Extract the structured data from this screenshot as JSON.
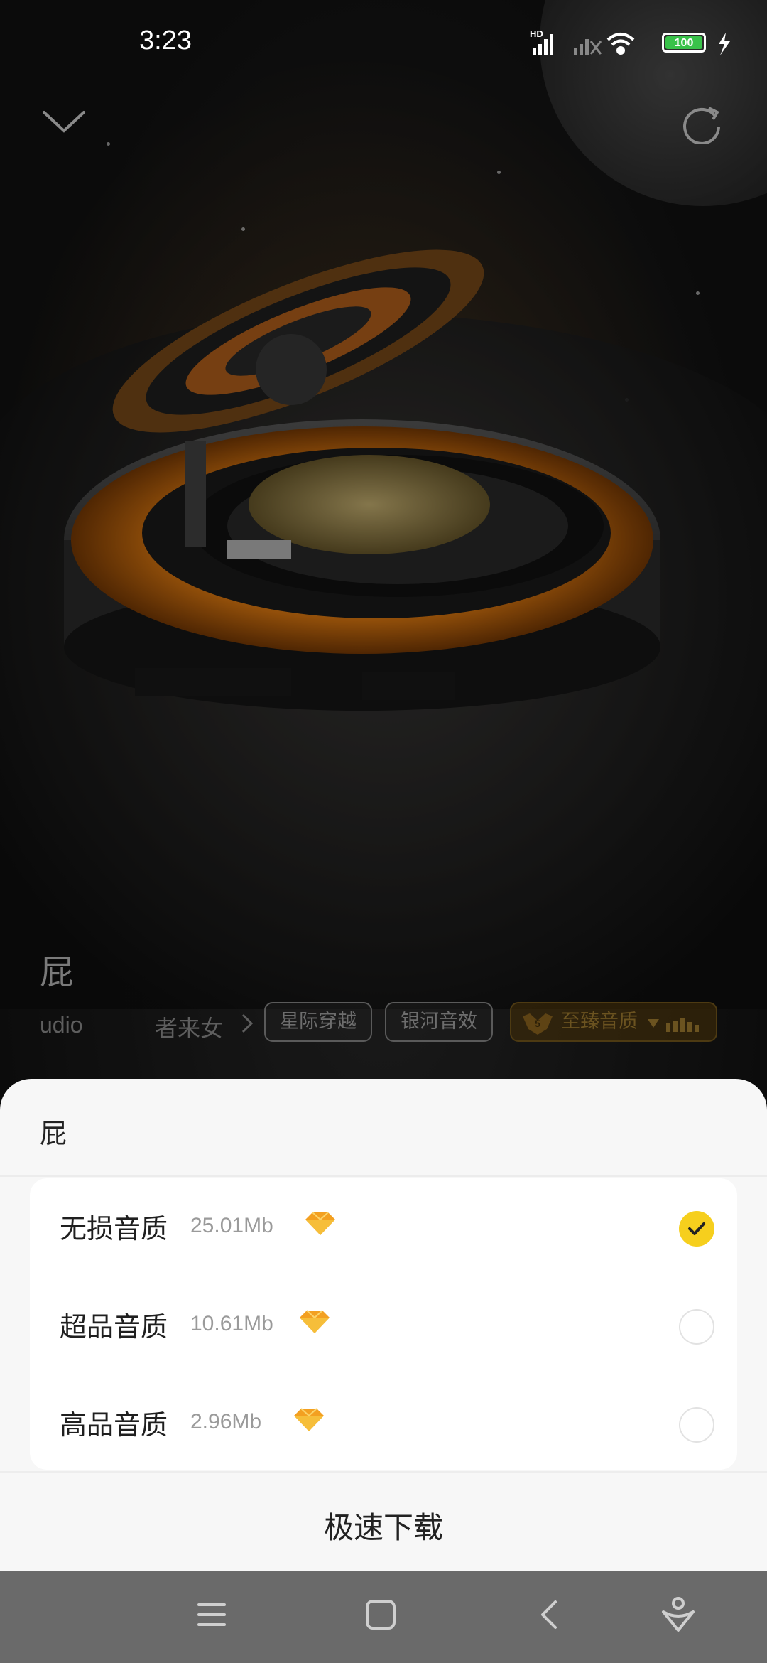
{
  "status_bar": {
    "time": "3:23",
    "network_label": "HD",
    "battery_level": "100",
    "icons": [
      "signal-icon",
      "signal-no-sim-icon",
      "wifi-icon",
      "battery-icon",
      "charging-icon"
    ]
  },
  "player": {
    "collapse_icon": "chevron-down-icon",
    "refresh_icon": "refresh-icon",
    "song_title": "屁",
    "artist_partial": "udio",
    "artist": "者来女",
    "chips": [
      "星际穿越",
      "银河音效"
    ],
    "quality_chip": {
      "badge": "5",
      "label": "至臻音质",
      "icon": "chevron-down-icon"
    }
  },
  "sheet": {
    "title": "屁",
    "options": [
      {
        "label": "无损音质",
        "size": "25.01Mb",
        "selected": true
      },
      {
        "label": "超品音质",
        "size": "10.61Mb",
        "selected": false
      },
      {
        "label": "高品音质",
        "size": "2.96Mb",
        "selected": false
      }
    ],
    "download_label": "极速下载"
  },
  "nav": {
    "items": [
      "menu-icon",
      "home-icon",
      "back-icon",
      "assistant-icon"
    ]
  },
  "colors": {
    "accent_yellow": "#f6cf1d",
    "gem_orange": "#f19a1f",
    "sheet_bg": "#f7f7f7"
  }
}
